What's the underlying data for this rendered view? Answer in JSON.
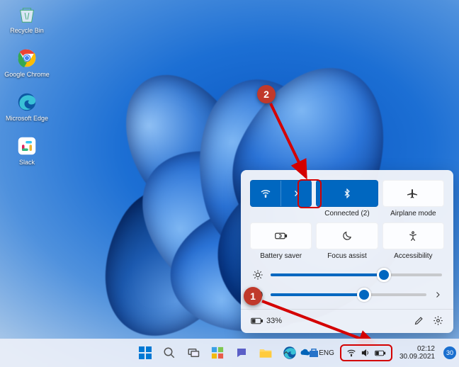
{
  "desktop_icons": [
    {
      "name": "recycle-bin",
      "label": "Recycle Bin"
    },
    {
      "name": "google-chrome",
      "label": "Google\nChrome"
    },
    {
      "name": "microsoft-edge",
      "label": "Microsoft\nEdge"
    },
    {
      "name": "slack",
      "label": "Slack"
    }
  ],
  "quick_settings": {
    "row1": [
      {
        "name": "wifi",
        "label": "",
        "active": true,
        "split": true
      },
      {
        "name": "bluetooth",
        "label": "Connected (2)",
        "active": true
      },
      {
        "name": "airplane",
        "label": "Airplane mode",
        "active": false
      }
    ],
    "row2": [
      {
        "name": "battery-saver",
        "label": "Battery saver",
        "active": false
      },
      {
        "name": "focus-assist",
        "label": "Focus assist",
        "active": false
      },
      {
        "name": "accessibility",
        "label": "Accessibility",
        "active": false
      }
    ],
    "brightness_pct": 66,
    "volume_pct": 60,
    "battery_text": "33%"
  },
  "taskbar": {
    "lang": "ENG",
    "time": "02:12",
    "date": "30.09.2021",
    "day_badge": "30"
  },
  "callouts": {
    "one": "1",
    "two": "2"
  }
}
